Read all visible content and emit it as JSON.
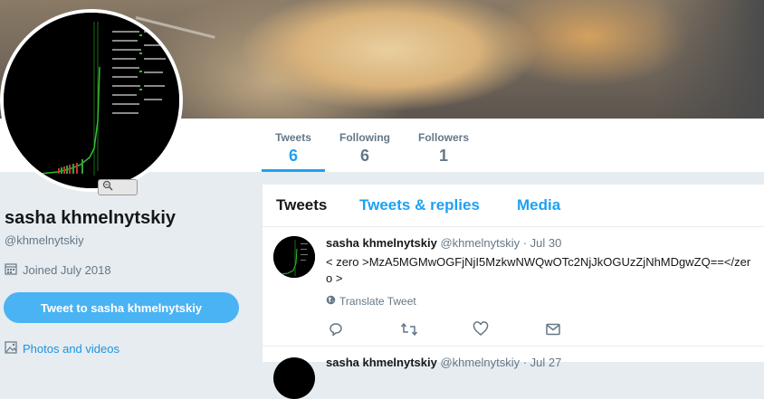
{
  "profile": {
    "name": "sasha khmelnytskiy",
    "handle": "@khmelnytskiy",
    "joined": "Joined July 2018",
    "tweet_to_label": "Tweet to sasha khmelnytskiy",
    "photos_label": "Photos and videos"
  },
  "stats": [
    {
      "label": "Tweets",
      "value": "6"
    },
    {
      "label": "Following",
      "value": "6"
    },
    {
      "label": "Followers",
      "value": "1"
    }
  ],
  "tabs": [
    {
      "label": "Tweets"
    },
    {
      "label": "Tweets & replies"
    },
    {
      "label": "Media"
    }
  ],
  "tweets": [
    {
      "name": "sasha khmelnytskiy",
      "handle": "@khmelnytskiy",
      "date": "· Jul 30",
      "text": "< zero >MzA5MGMwOGFjNjI5MzkwNWQwOTc2NjJkOGUzZjNhMDgwZQ==</zero >",
      "translate": "Translate Tweet"
    },
    {
      "name": "sasha khmelnytskiy",
      "handle": "@khmelnytskiy",
      "date": "· Jul 27"
    }
  ],
  "colors": {
    "accent": "#1da1f2",
    "button": "#4ab3f4",
    "muted": "#657786",
    "background": "#e6ecf0"
  },
  "icons": {
    "joined": "calendar-icon",
    "photos": "image-icon",
    "translate": "globe-icon",
    "reply": "reply-icon",
    "retweet": "retweet-icon",
    "like": "heart-icon",
    "message": "envelope-icon",
    "zoom": "magnifier-icon"
  }
}
